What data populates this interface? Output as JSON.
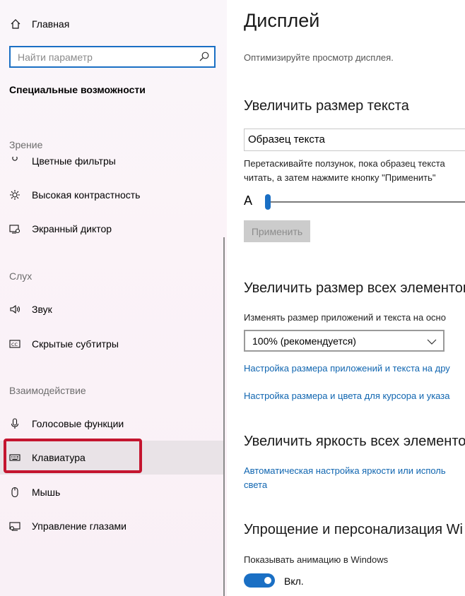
{
  "sidebar": {
    "home_label": "Главная",
    "search_placeholder": "Найти параметр",
    "section_title": "Специальные возможности",
    "groups": {
      "vision": "Зрение",
      "hearing": "Слух",
      "interaction": "Взаимодействие"
    },
    "items": {
      "color_filters": "Цветные фильтры",
      "high_contrast": "Высокая контрастность",
      "narrator": "Экранный диктор",
      "audio": "Звук",
      "captions": "Скрытые субтитры",
      "speech": "Голосовые функции",
      "keyboard": "Клавиатура",
      "mouse": "Мышь",
      "eye_control": "Управление глазами"
    },
    "selected_item": "keyboard"
  },
  "main": {
    "title": "Дисплей",
    "description": "Оптимизируйте просмотр дисплея.",
    "text_size": {
      "heading": "Увеличить размер текста",
      "sample_text": "Образец текста",
      "instructions_line1": "Перетаскивайте ползунок, пока образец текста",
      "instructions_line2": "читать, а затем нажмите кнопку \"Применить\"",
      "slider_label": "A",
      "slider_value_percent": 0,
      "apply_label": "Применить"
    },
    "everything_size": {
      "heading": "Увеличить размер всех элементов",
      "label": "Изменять размер приложений и текста на осно",
      "selected_option": "100% (рекомендуется)",
      "link1": "Настройка размера приложений и текста на дру",
      "link2": "Настройка размера и цвета для курсора и указа"
    },
    "brightness": {
      "heading": "Увеличить яркость всех элементо",
      "link_line1": "Автоматическая настройка яркости или исполь",
      "link_line2": "света"
    },
    "personalize": {
      "heading": "Упрощение и персонализация Wi",
      "animation_label": "Показывать анимацию в Windows",
      "toggle_state": "Вкл."
    }
  },
  "colors": {
    "accent": "#1a6fc4",
    "link": "#0f65b0",
    "highlight_border": "#c4152f"
  }
}
